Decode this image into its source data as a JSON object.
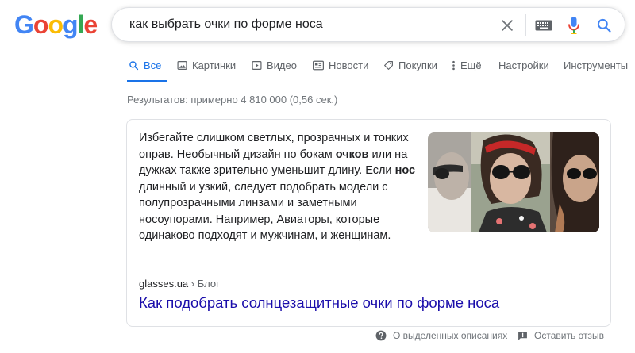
{
  "logo": {
    "letters": [
      "G",
      "o",
      "o",
      "g",
      "l",
      "e"
    ],
    "colors": [
      "#4285f4",
      "#ea4335",
      "#fbbc05",
      "#4285f4",
      "#34a853",
      "#ea4335"
    ]
  },
  "search": {
    "query": "как выбрать очки по форме носа",
    "icons": {
      "clear": "close-icon",
      "keyboard": "keyboard-icon",
      "voice": "mic-icon",
      "submit": "search-icon"
    }
  },
  "tabs": [
    {
      "label": "Все",
      "icon": "search-icon",
      "active": true
    },
    {
      "label": "Картинки",
      "icon": "image-icon",
      "active": false
    },
    {
      "label": "Видео",
      "icon": "video-icon",
      "active": false
    },
    {
      "label": "Новости",
      "icon": "news-icon",
      "active": false
    },
    {
      "label": "Покупки",
      "icon": "tag-icon",
      "active": false
    },
    {
      "label": "Ещё",
      "icon": "more-vert-icon",
      "active": false
    },
    {
      "label": "Настройки",
      "active": false
    },
    {
      "label": "Инструменты",
      "active": false
    }
  ],
  "results": {
    "stats": "Результатов: примерно 4 810 000 (0,56 сек.)"
  },
  "snippet": {
    "parts": [
      {
        "text": "Избегайте слишком светлых, прозрачных и тонких оправ. Необычный дизайн по бокам ",
        "bold": false
      },
      {
        "text": "очков",
        "bold": true
      },
      {
        "text": " или на дужках также зрительно уменьшит длину. Если ",
        "bold": false
      },
      {
        "text": "нос",
        "bold": true
      },
      {
        "text": " длинный и узкий, следует подобрать модели с полупрозрачными линзами и заметными носоупорами. Например, Авиаторы, которые одинаково подходят и мужчинам, и женщинам.",
        "bold": false
      }
    ],
    "source_site": "glasses.ua",
    "source_separator": " › ",
    "source_path": "Блог",
    "title": "Как подобрать солнцезащитные очки по форме носа"
  },
  "footer": {
    "about": "О выделенных описаниях",
    "feedback": "Оставить отзыв"
  },
  "colors": {
    "link": "#1a0dab",
    "accent": "#1a73e8",
    "secondary_text": "#70757a",
    "tab_text": "#5f6368"
  }
}
